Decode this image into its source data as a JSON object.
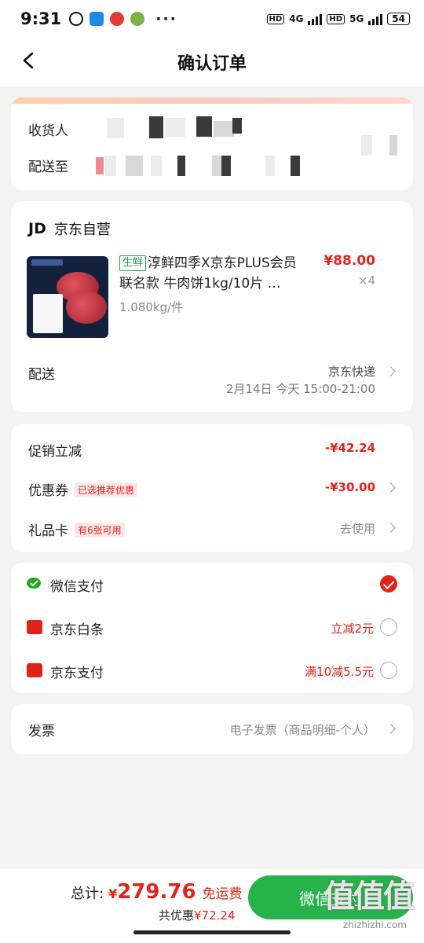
{
  "status_bar": {
    "time": "9:31",
    "dots": "···",
    "net1": "4G",
    "net2": "5G",
    "hd": "HD",
    "battery": "54"
  },
  "header": {
    "title": "确认订单"
  },
  "address": {
    "receiver_label": "收货人",
    "ship_to_label": "配送至"
  },
  "store": {
    "logo": "JD",
    "name": "京东自营",
    "product": {
      "tag": "生鲜",
      "title": "淳鲜四季X京东PLUS会员联名款 牛肉饼1kg/10片 …",
      "weight": "1.080kg/件",
      "price": "¥88.00",
      "qty": "×4"
    },
    "shipping": {
      "label": "配送",
      "method": "京东快递",
      "time": "2月14日 今天 15:00-21:00"
    }
  },
  "promotions": {
    "promo_label": "促销立减",
    "promo_value": "-¥42.24",
    "coupon_label": "优惠券",
    "coupon_tag": "已选推荐优惠",
    "coupon_value": "-¥30.00",
    "giftcard_label": "礼品卡",
    "giftcard_tag": "有6张可用",
    "giftcard_value": "去使用"
  },
  "payment": {
    "options": [
      {
        "label": "微信支付",
        "promo": "",
        "selected": true,
        "color": "#1aad19"
      },
      {
        "label": "京东白条",
        "promo": "立减2元",
        "selected": false,
        "color": "#e2231a"
      },
      {
        "label": "京东支付",
        "promo": "满10减5.5元",
        "selected": false,
        "color": "#e2231a"
      }
    ]
  },
  "invoice": {
    "label": "发票",
    "value": "电子发票（商品明细-个人）"
  },
  "footer": {
    "total_label": "总计:",
    "currency": "¥",
    "total": "279.76",
    "free_shipping": "免运费",
    "discount_label": "共优惠",
    "discount": "¥72.24",
    "pay_button": "微信支付"
  },
  "watermark": {
    "text": "值值值",
    "url": "zhizhizhi.com"
  },
  "colors": {
    "accent_red": "#e2231a",
    "wechat_green": "#27b24a"
  }
}
